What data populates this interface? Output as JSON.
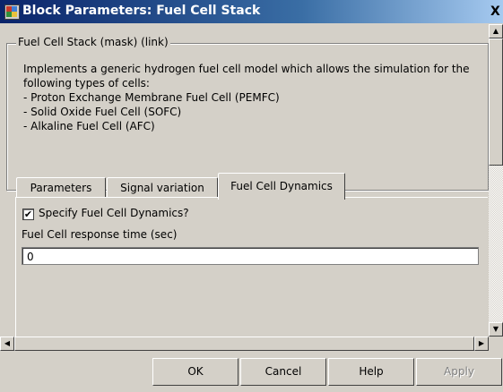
{
  "window": {
    "title": "Block Parameters: Fuel Cell Stack",
    "close_glyph": "X"
  },
  "group": {
    "legend": "Fuel Cell Stack (mask) (link)",
    "description_lines": [
      "Implements a generic hydrogen fuel cell model which allows the simulation for the",
      "following types of cells:",
      "- Proton Exchange Membrane Fuel Cell (PEMFC)",
      "- Solid Oxide Fuel Cell (SOFC)",
      "- Alkaline Fuel Cell (AFC)"
    ]
  },
  "tabs": [
    {
      "label": "Parameters"
    },
    {
      "label": "Signal variation"
    },
    {
      "label": "Fuel Cell Dynamics"
    }
  ],
  "active_tab": "Fuel Cell Dynamics",
  "dynamics": {
    "checkbox_label": "Specify Fuel Cell Dynamics?",
    "checkbox_checked": true,
    "checkbox_glyph": "✔",
    "response_label": "Fuel Cell response time (sec)",
    "response_value": "0"
  },
  "scrollbars": {
    "up_glyph": "▲",
    "down_glyph": "▼",
    "left_glyph": "◀",
    "right_glyph": "▶"
  },
  "buttons": {
    "ok": "OK",
    "cancel": "Cancel",
    "help": "Help",
    "apply": "Apply"
  },
  "colors": {
    "dialog_bg": "#d4d0c8",
    "title_bar_start": "#0a246a",
    "title_bar_end": "#a6caf0"
  }
}
